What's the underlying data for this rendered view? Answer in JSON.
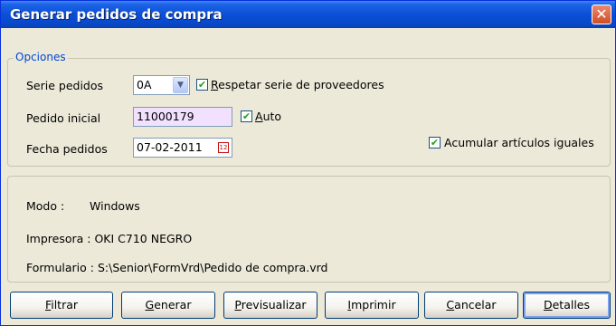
{
  "window": {
    "title": "Generar pedidos de compra",
    "close_glyph": "✕"
  },
  "opciones": {
    "legend": "Opciones",
    "serie": {
      "label": "Serie pedidos",
      "value": "0A"
    },
    "respetar": {
      "label_rest": "espetar serie de proveedores",
      "label_u": "R",
      "checked": true
    },
    "pedido_inicial": {
      "label": "Pedido inicial",
      "value": "11000179"
    },
    "auto": {
      "label_u": "A",
      "label_rest": "uto",
      "checked": true
    },
    "fecha": {
      "label": "Fecha pedidos",
      "value": "07-02-2011",
      "icon": "calendar-icon"
    },
    "acumular": {
      "label": "Acumular artículos iguales",
      "checked": true
    }
  },
  "info": {
    "modo": "Modo :       Windows",
    "impresora": "Impresora : OKI C710 NEGRO",
    "formulario": "Formulario : S:\\Senior\\FormVrd\\Pedido de compra.vrd"
  },
  "buttons": [
    {
      "u": "F",
      "rest": "iltrar"
    },
    {
      "u": "G",
      "rest": "enerar"
    },
    {
      "u": "P",
      "rest": "revisualizar"
    },
    {
      "u": "I",
      "rest": "mprimir"
    },
    {
      "u": "C",
      "rest": "ancelar"
    },
    {
      "u": "D",
      "rest": "etalles"
    }
  ]
}
